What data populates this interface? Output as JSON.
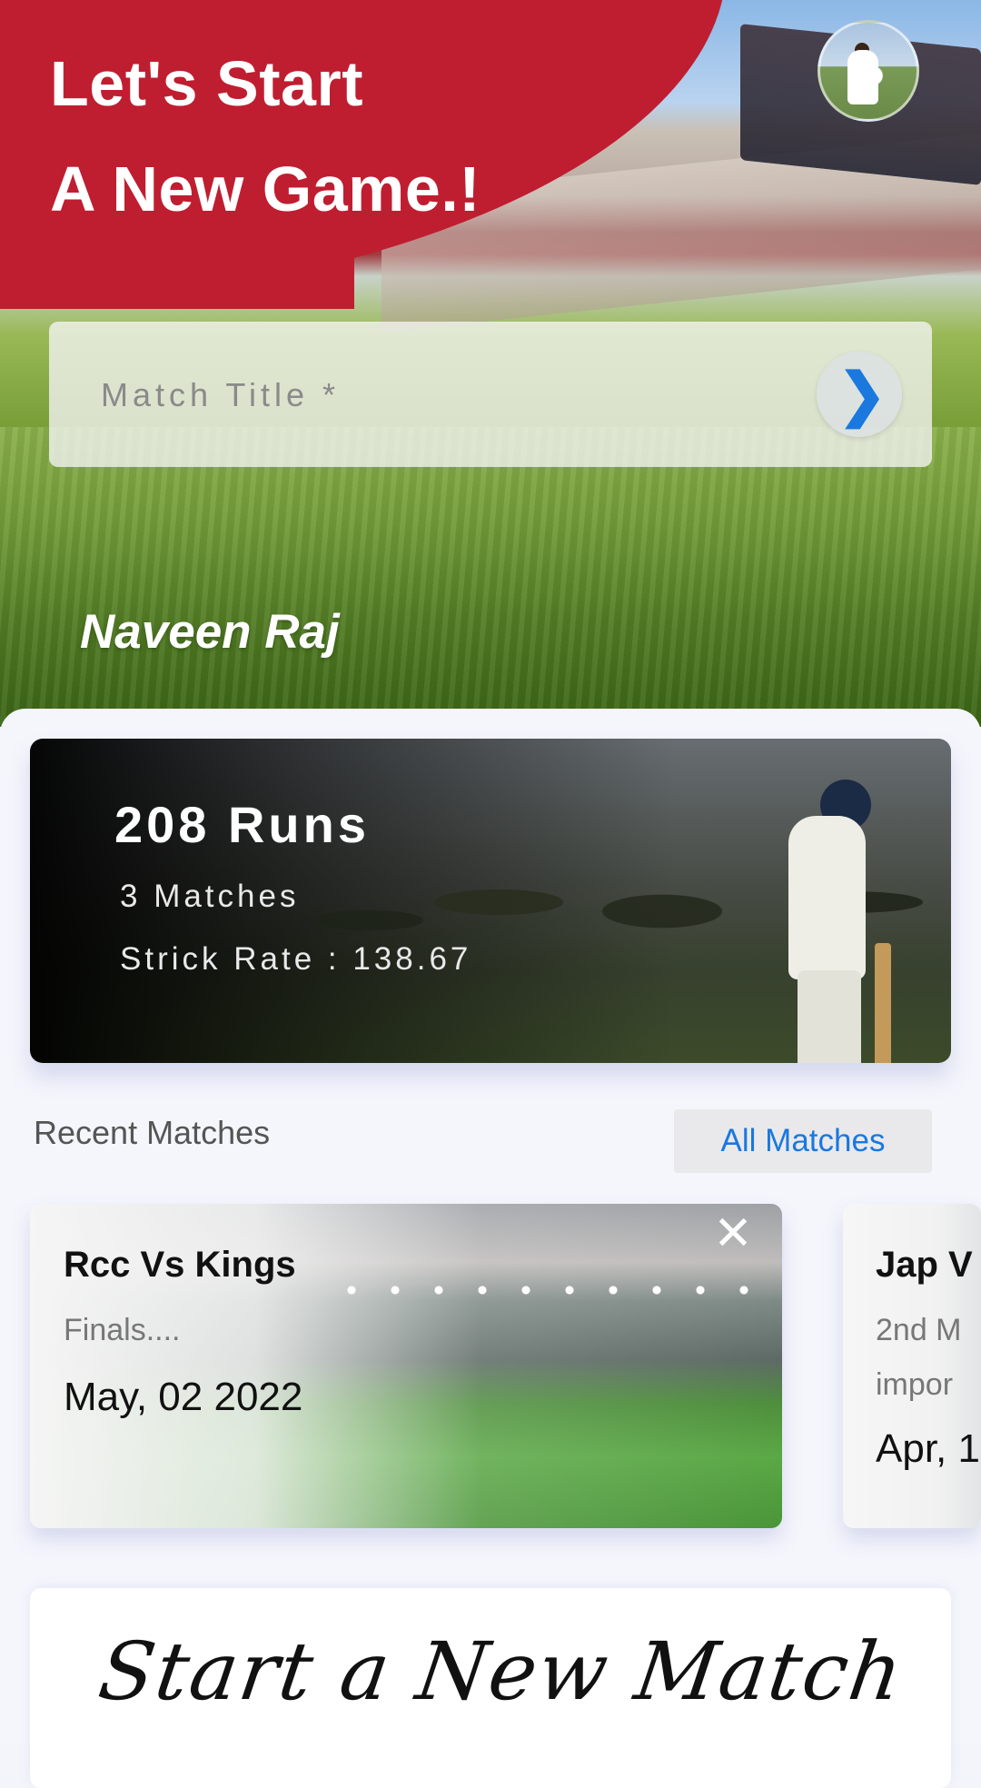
{
  "hero": {
    "headline_line1": "Let's Start",
    "headline_line2": "A New Game.!",
    "match_title_placeholder": "Match Title *",
    "go_icon": "chevron-right-icon",
    "player_name": "Naveen Raj",
    "accent_color": "#bf1e30"
  },
  "stats": {
    "runs": "208 Runs",
    "matches": "3 Matches",
    "strike_rate": "Strick Rate : 138.67"
  },
  "recent": {
    "title": "Recent Matches",
    "all_button": "All Matches",
    "matches": [
      {
        "title": "Rcc Vs Kings",
        "subtitle": "Finals....",
        "date": "May, 02 2022"
      },
      {
        "title": "Jap V",
        "subtitle_line1": "2nd M",
        "subtitle_line2": "impor",
        "date": "Apr, 1"
      }
    ]
  },
  "new_match": {
    "title": "Start a New Match"
  },
  "colors": {
    "link_blue": "#1a78de",
    "brand_red": "#bf1e30"
  }
}
